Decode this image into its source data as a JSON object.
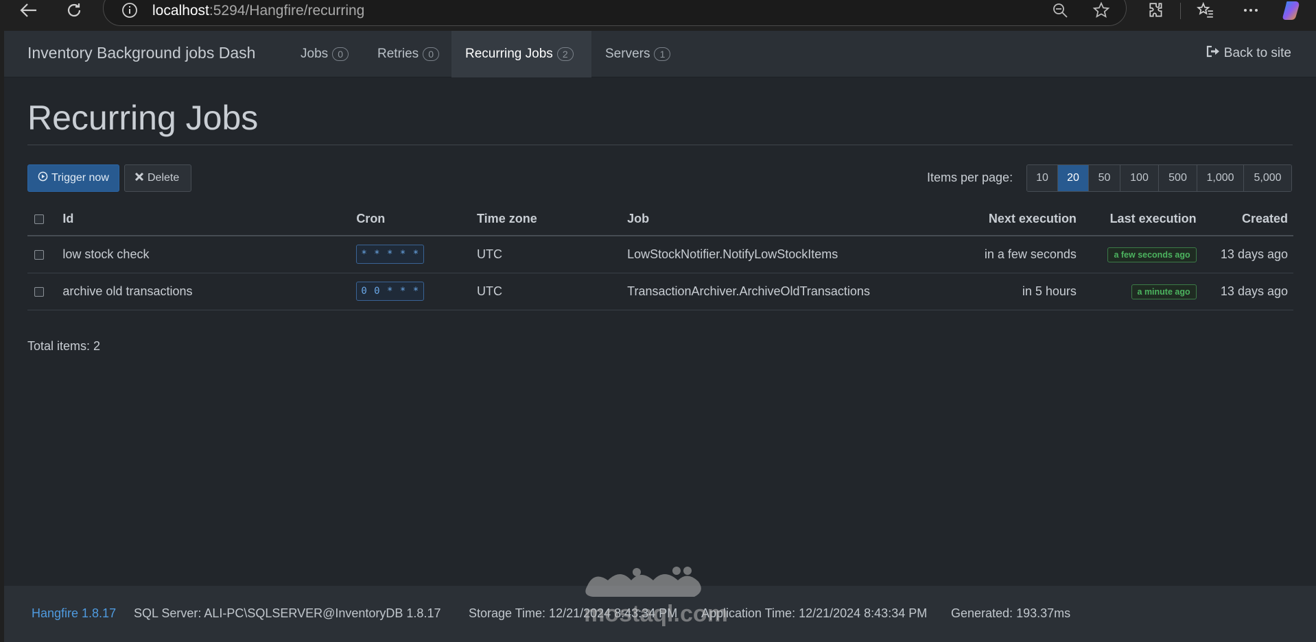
{
  "browser": {
    "url_host": "localhost",
    "url_path": ":5294/Hangfire/recurring"
  },
  "navbar": {
    "brand": "Inventory Background jobs Dash",
    "items": [
      {
        "label": "Jobs",
        "count": "0",
        "active": false
      },
      {
        "label": "Retries",
        "count": "0",
        "active": false
      },
      {
        "label": "Recurring Jobs",
        "count": "2",
        "active": true
      },
      {
        "label": "Servers",
        "count": "1",
        "active": false
      }
    ],
    "back_label": "Back to site"
  },
  "page": {
    "title": "Recurring Jobs"
  },
  "toolbar": {
    "trigger_label": "Trigger now",
    "delete_label": "Delete",
    "items_per_page_label": "Items per page:",
    "page_sizes": [
      "10",
      "20",
      "50",
      "100",
      "500",
      "1,000",
      "5,000"
    ],
    "selected_page_size": "20"
  },
  "table": {
    "headers": [
      "Id",
      "Cron",
      "Time zone",
      "Job",
      "Next execution",
      "Last execution",
      "Created"
    ],
    "rows": [
      {
        "id": "low stock check",
        "cron": "* * * * *",
        "timezone": "UTC",
        "job": "LowStockNotifier.NotifyLowStockItems",
        "next": "in a few seconds",
        "last": "a few seconds ago",
        "created": "13 days ago"
      },
      {
        "id": "archive old transactions",
        "cron": "0 0 * * *",
        "timezone": "UTC",
        "job": "TransactionArchiver.ArchiveOldTransactions",
        "next": "in 5 hours",
        "last": "a minute ago",
        "created": "13 days ago"
      }
    ]
  },
  "summary": {
    "total": "Total items: 2"
  },
  "footer": {
    "version": "Hangfire 1.8.17",
    "storage": "SQL Server: ALI-PC\\SQLSERVER@InventoryDB 1.8.17",
    "storage_time": "Storage Time: 12/21/2024 8:43:34 PM",
    "app_time": "Application Time: 12/21/2024 8:43:34 PM",
    "generated": "Generated: 193.37ms"
  },
  "watermark": {
    "text": "mostaql.com"
  },
  "colors": {
    "accent": "#285a90",
    "success": "#4cb35f",
    "link": "#4f9be0",
    "background": "#22262b",
    "navbar": "#2b3036"
  },
  "icons": [
    "back-arrow-icon",
    "refresh-icon",
    "info-icon",
    "zoom-out-icon",
    "star-icon",
    "extensions-icon",
    "favorites-icon",
    "more-icon",
    "copilot-icon",
    "sign-out-icon",
    "play-circle-icon",
    "close-icon"
  ]
}
